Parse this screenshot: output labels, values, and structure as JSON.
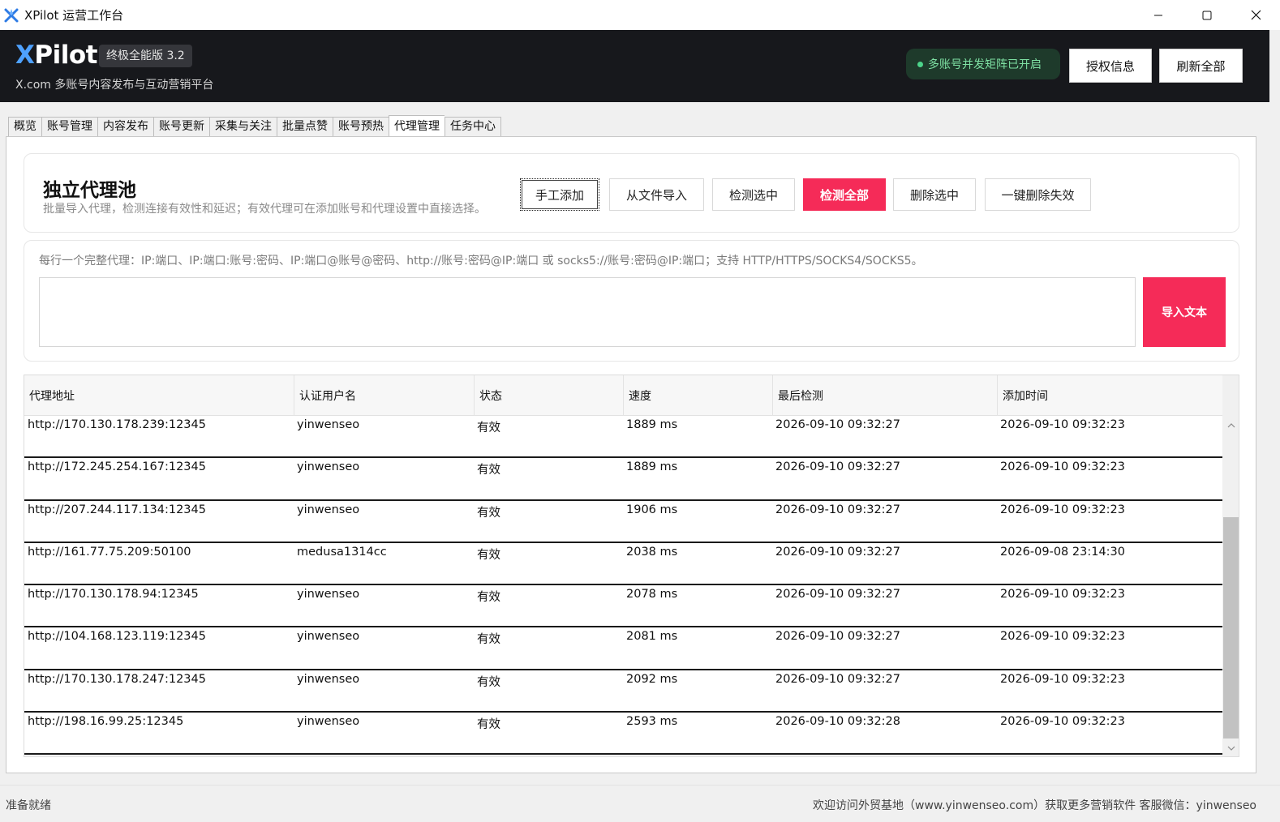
{
  "window": {
    "title": "XPilot 运营工作台"
  },
  "header": {
    "logo_x": "X",
    "logo_rest": "Pilot",
    "version": "终极全能版 3.2",
    "subtitle": "X.com 多账号内容发布与互动营销平台",
    "status_pill": "多账号并发矩阵已开启",
    "license_button": "授权信息",
    "refresh_button": "刷新全部"
  },
  "tabs": [
    "概览",
    "账号管理",
    "内容发布",
    "账号更新",
    "采集与关注",
    "批量点赞",
    "账号预热",
    "代理管理",
    "任务中心"
  ],
  "active_tab": "代理管理",
  "pool": {
    "title": "独立代理池",
    "description": "批量导入代理，检测连接有效性和延迟；有效代理可在添加账号和代理设置中直接选择。",
    "buttons": {
      "manual_add": "手工添加",
      "import_file": "从文件导入",
      "check_selected": "检测选中",
      "check_all": "检测全部",
      "delete_selected": "删除选中",
      "delete_invalid": "一键删除失效"
    }
  },
  "import": {
    "hint": "每行一个完整代理：IP:端口、IP:端口:账号:密码、IP:端口@账号@密码、http://账号:密码@IP:端口 或 socks5://账号:密码@IP:端口；支持 HTTP/HTTPS/SOCKS4/SOCKS5。",
    "text_value": "",
    "button": "导入文本"
  },
  "table": {
    "columns": [
      "代理地址",
      "认证用户名",
      "状态",
      "速度",
      "最后检测",
      "添加时间"
    ],
    "rows": [
      [
        "http://170.130.178.239:12345",
        "yinwenseo",
        "有效",
        "1889 ms",
        "2026-09-10 09:32:27",
        "2026-09-10 09:32:23"
      ],
      [
        "http://172.245.254.167:12345",
        "yinwenseo",
        "有效",
        "1889 ms",
        "2026-09-10 09:32:27",
        "2026-09-10 09:32:23"
      ],
      [
        "http://207.244.117.134:12345",
        "yinwenseo",
        "有效",
        "1906 ms",
        "2026-09-10 09:32:27",
        "2026-09-10 09:32:23"
      ],
      [
        "http://161.77.75.209:50100",
        "medusa1314cc",
        "有效",
        "2038 ms",
        "2026-09-10 09:32:27",
        "2026-09-08 23:14:30"
      ],
      [
        "http://170.130.178.94:12345",
        "yinwenseo",
        "有效",
        "2078 ms",
        "2026-09-10 09:32:27",
        "2026-09-10 09:32:23"
      ],
      [
        "http://104.168.123.119:12345",
        "yinwenseo",
        "有效",
        "2081 ms",
        "2026-09-10 09:32:27",
        "2026-09-10 09:32:23"
      ],
      [
        "http://170.130.178.247:12345",
        "yinwenseo",
        "有效",
        "2092 ms",
        "2026-09-10 09:32:27",
        "2026-09-10 09:32:23"
      ],
      [
        "http://198.16.99.25:12345",
        "yinwenseo",
        "有效",
        "2593 ms",
        "2026-09-10 09:32:28",
        "2026-09-10 09:32:23"
      ]
    ]
  },
  "statusbar": {
    "left": "准备就绪",
    "right": "欢迎访问外贸基地（www.yinwenseo.com）获取更多营销软件   客服微信：yinwenseo"
  },
  "colors": {
    "accent": "#f52b58",
    "header_bg": "#17181c",
    "logo_x": "#4ea1ff",
    "status_green": "#7ee0a3"
  },
  "icons": {
    "app": "xpilot-app-icon",
    "minimize": "minimize-icon",
    "maximize": "maximize-icon",
    "close": "close-icon",
    "scroll_up": "chevron-up-icon",
    "scroll_down": "chevron-down-icon"
  }
}
